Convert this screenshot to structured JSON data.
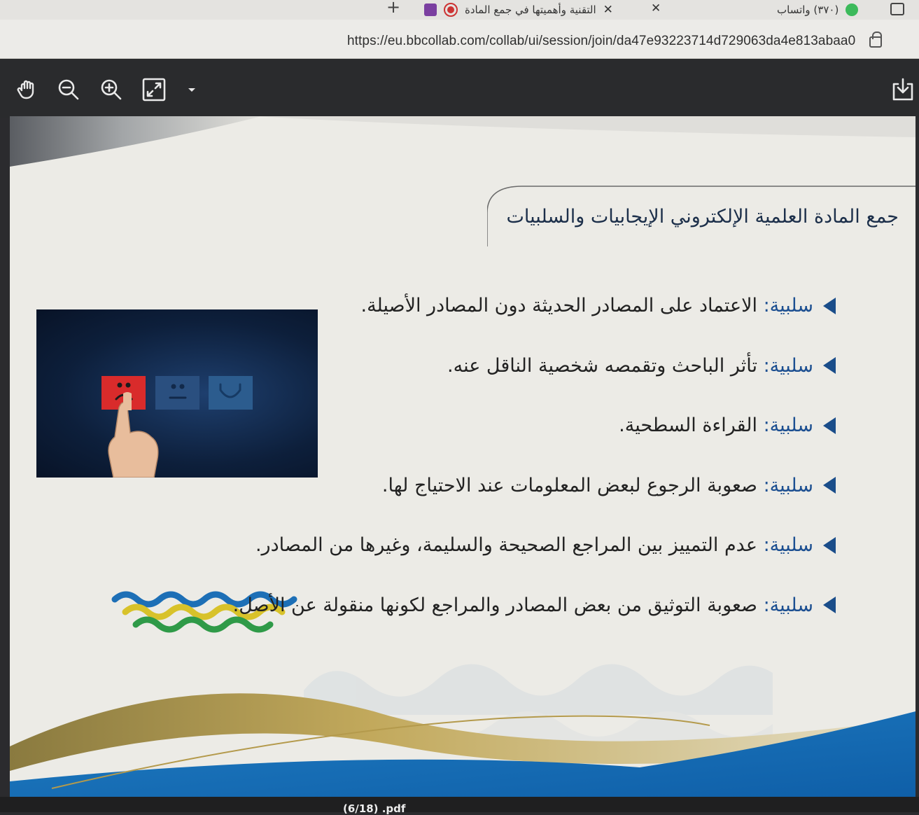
{
  "browser": {
    "tabs": [
      {
        "title": "(٣٧٠) واتساب"
      },
      {
        "title": "التقنية وأهميتها في جمع المادة"
      }
    ],
    "url": "https://eu.bbcollab.com/collab/ui/session/join/da47e93223714d729063da4e813abaa0"
  },
  "icons": {
    "new_tab": "plus-icon",
    "window": "window-icon",
    "lock": "lock-icon",
    "pan": "hand-icon",
    "zoom_out": "zoom-out-icon",
    "zoom_in": "zoom-in-icon",
    "fit": "fit-to-screen-icon",
    "more": "chevron-down-icon",
    "download": "download-icon"
  },
  "slide": {
    "title": "جمع المادة العلمية الإلكتروني الإيجابيات والسلبيات",
    "bullets": [
      {
        "label": "سلبية:",
        "text": " الاعتماد على المصادر الحديثة دون المصادر الأصيلة."
      },
      {
        "label": "سلبية:",
        "text": " تأثر الباحث وتقمصه شخصية الناقل عنه."
      },
      {
        "label": "سلبية:",
        "text": " القراءة السطحية."
      },
      {
        "label": "سلبية:",
        "text": " صعوبة الرجوع لبعض المعلومات عند الاحتياج لها."
      },
      {
        "label": "سلبية:",
        "text": " عدم التمييز بين المراجع الصحيحة والسليمة، وغيرها من المصادر."
      },
      {
        "label": "سلبية:",
        "text": " صعوبة التوثيق من بعض المصادر والمراجع لكونها منقولة عن الأصل."
      }
    ]
  },
  "footer": {
    "file_label": "(6/18) .pdf"
  },
  "colors": {
    "accent_blue": "#1c4f91",
    "title_navy": "#1c2f4a",
    "sad_red": "#d92b2b",
    "toolbar_bg": "#2a2b2d"
  }
}
